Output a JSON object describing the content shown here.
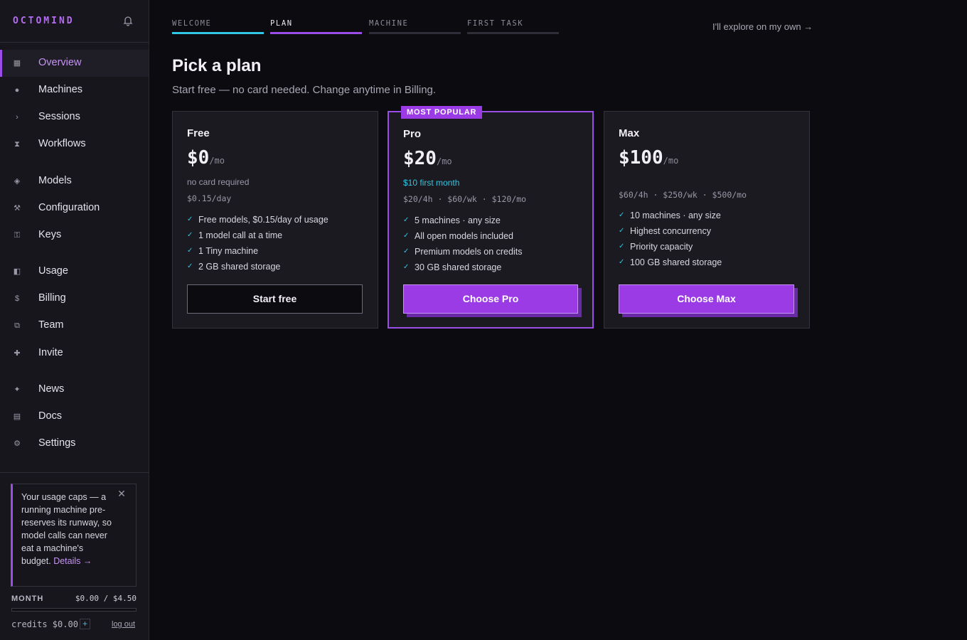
{
  "brand": {
    "logo_text": "OCTOMIND"
  },
  "sidebar": {
    "items": [
      {
        "label": "Overview",
        "icon": "grid-icon",
        "glyph": "▦",
        "active": true
      },
      {
        "label": "Machines",
        "icon": "dot-icon",
        "glyph": "●"
      },
      {
        "label": "Sessions",
        "icon": "chevron-right-icon",
        "glyph": "›"
      },
      {
        "label": "Workflows",
        "icon": "hourglass-icon",
        "glyph": "⧗"
      },
      {
        "label": "Models",
        "icon": "diamond-icon",
        "glyph": "◈"
      },
      {
        "label": "Configuration",
        "icon": "tools-icon",
        "glyph": "⚒"
      },
      {
        "label": "Keys",
        "icon": "key-icon",
        "glyph": "⚿"
      },
      {
        "label": "Usage",
        "icon": "half-square-icon",
        "glyph": "◧"
      },
      {
        "label": "Billing",
        "icon": "dollar-icon",
        "glyph": "$"
      },
      {
        "label": "Team",
        "icon": "team-icon",
        "glyph": "⧉"
      },
      {
        "label": "Invite",
        "icon": "plus-icon",
        "glyph": "✚"
      },
      {
        "label": "News",
        "icon": "sparkle-icon",
        "glyph": "✦"
      },
      {
        "label": "Docs",
        "icon": "doc-icon",
        "glyph": "▤"
      },
      {
        "label": "Settings",
        "icon": "gear-icon",
        "glyph": "⚙"
      }
    ]
  },
  "notice": {
    "text": "Your usage caps — a running machine pre-reserves its runway, so model calls can never eat a machine's budget.",
    "link": "Details →",
    "close_glyph": "✕"
  },
  "usage": {
    "label": "MONTH",
    "value": "$0.00 / $4.50",
    "fraction": 0.0,
    "credits": "credits $0.00",
    "plus_glyph": "+",
    "logout": "log out"
  },
  "steps": [
    {
      "label": "WELCOME",
      "color": "#2fc7e3",
      "state": "done"
    },
    {
      "label": "PLAN",
      "color": "#9b4de8",
      "state": "active"
    },
    {
      "label": "MACHINE",
      "color": "#2f2e38",
      "state": "todo"
    },
    {
      "label": "FIRST TASK",
      "color": "#2f2e38",
      "state": "todo"
    }
  ],
  "explore_link": "I'll explore on my own →",
  "page": {
    "title": "Pick a plan",
    "subtitle": "Start free — no card needed. Change anytime in Billing."
  },
  "plans": [
    {
      "name": "Free",
      "price": "$0",
      "unit": "/mo",
      "promo": "no card required",
      "rates": "$0.15/day",
      "features": [
        "Free models, $0.15/day of usage",
        "1 model call at a time",
        "1 Tiny machine",
        "2 GB shared storage"
      ],
      "button": "Start free"
    },
    {
      "name": "Pro",
      "badge": "MOST POPULAR",
      "price": "$20",
      "unit": "/mo",
      "promo": "$10 first month",
      "rates": "$20/4h · $60/wk · $120/mo",
      "features": [
        "5 machines · any size",
        "All open models included",
        "Premium models on credits",
        "30 GB shared storage"
      ],
      "button": "Choose Pro"
    },
    {
      "name": "Max",
      "price": "$100",
      "unit": "/mo",
      "promo": "",
      "rates": "$60/4h · $250/wk · $500/mo",
      "features": [
        "10 machines · any size",
        "Highest concurrency",
        "Priority capacity",
        "100 GB shared storage"
      ],
      "button": "Choose Max"
    }
  ],
  "check_glyph": "✓",
  "colors": {
    "accent": "#9b4de8",
    "cyan": "#2fc7e3",
    "background": "#0c0b10",
    "card": "#1b1a21"
  }
}
